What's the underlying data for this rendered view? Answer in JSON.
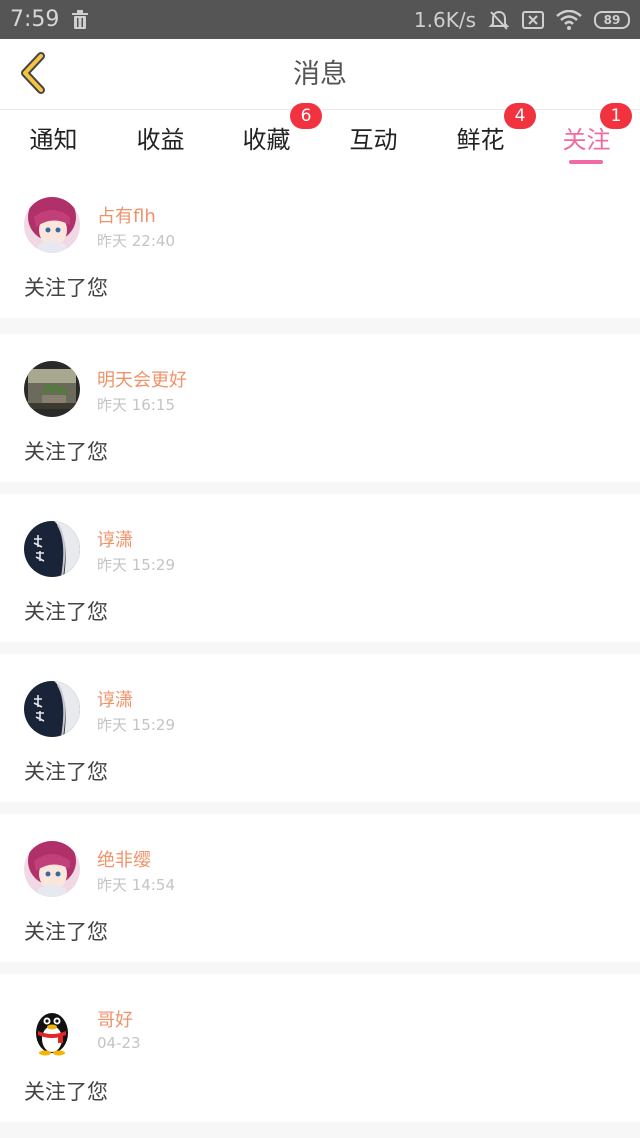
{
  "status_bar": {
    "time": "7:59",
    "network_speed": "1.6K/s",
    "battery": "89",
    "icons": [
      "trash-icon",
      "mute-bell-icon",
      "sim-off-icon",
      "wifi-icon",
      "battery-icon"
    ]
  },
  "header": {
    "title": "消息",
    "back_icon": "chevron-left-icon",
    "accent_color": "#f5c542"
  },
  "tabs": [
    {
      "label": "通知",
      "badge": "",
      "active": false
    },
    {
      "label": "收益",
      "badge": "",
      "active": false
    },
    {
      "label": "收藏",
      "badge": "6",
      "active": false
    },
    {
      "label": "互动",
      "badge": "",
      "active": false
    },
    {
      "label": "鲜花",
      "badge": "4",
      "active": false
    },
    {
      "label": "关注",
      "badge": "1",
      "active": true
    }
  ],
  "colors": {
    "active_tab": "#f26aa3",
    "badge": "#f2323f",
    "username": "#f0926a",
    "timestamp": "#c4c4c4"
  },
  "feed": [
    {
      "name": "占有flh",
      "time": "昨天 22:40",
      "message": "关注了您",
      "avatar": "anime-girl-avatar"
    },
    {
      "name": "明天会更好",
      "time": "昨天 16:15",
      "message": "关注了您",
      "avatar": "plant-photo-avatar"
    },
    {
      "name": "谆潇",
      "time": "昨天 15:29",
      "message": "关注了您",
      "avatar": "calligraphy-avatar"
    },
    {
      "name": "谆潇",
      "time": "昨天 15:29",
      "message": "关注了您",
      "avatar": "calligraphy-avatar"
    },
    {
      "name": "绝非缨",
      "time": "昨天 14:54",
      "message": "关注了您",
      "avatar": "anime-girl-avatar"
    },
    {
      "name": "哥好",
      "time": "04-23",
      "message": "关注了您",
      "avatar": "qq-penguin-avatar"
    }
  ]
}
